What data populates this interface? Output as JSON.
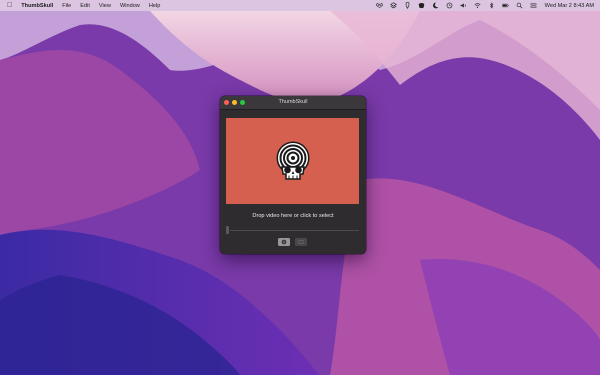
{
  "menubar": {
    "app_name": "ThumbSkull",
    "menus": [
      "File",
      "Edit",
      "View",
      "Window",
      "Help"
    ],
    "clock": "Wed Mar 2  8:43 AM",
    "status_icons": [
      "dropbox-icon",
      "layers-icon",
      "wrench-icon",
      "mask-icon",
      "moon-icon",
      "time-machine-icon",
      "volume-icon",
      "wifi-icon",
      "bluetooth-icon",
      "battery-icon",
      "search-icon",
      "control-center-icon"
    ]
  },
  "window": {
    "title": "ThumbSkull",
    "drop_text": "Drop video here or click to select",
    "accent_color": "#d5604f"
  }
}
